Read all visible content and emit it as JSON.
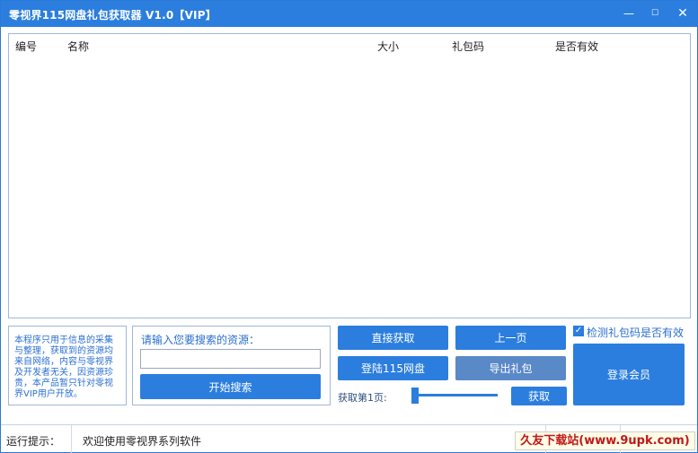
{
  "window": {
    "title": "零视界115网盘礼包获取器 V1.0【VIP】",
    "minimize_glyph": "—",
    "maximize_glyph": "☐",
    "close_glyph": "✕"
  },
  "list": {
    "columns": [
      "编号",
      "名称",
      "大小",
      "礼包码",
      "是否有效"
    ],
    "rows": []
  },
  "notice": {
    "text": "本程序只用于信息的采集与整理，获取到的资源均来自网络，内容与零视界及开发者无关，因资源珍贵，本产品暂只针对零视界VIP用户开放。"
  },
  "search": {
    "label": "请输入您要搜索的资源：",
    "value": "",
    "button_label": "开始搜索"
  },
  "actions": {
    "direct_fetch": "直接获取",
    "prev_page": "上一页",
    "login_115": "登陆115网盘",
    "export_gift": "导出礼包",
    "page_label": "获取第1页:",
    "page_value": 1,
    "fetch": "获取",
    "login_member": "登录会员"
  },
  "options": {
    "check_validity_label": "检测礼包码是否有效",
    "check_validity_checked": true
  },
  "status": {
    "label": "运行提示：",
    "message": "欢迎使用零视界系列软件"
  },
  "watermark": {
    "text": "久友下载站(www.9upk.com)"
  },
  "colors": {
    "accent": "#2b7ede",
    "notice_text": "#2b6fd0",
    "watermark_text": "#c01818"
  },
  "icons": {
    "checkbox": "checkmark-icon"
  }
}
